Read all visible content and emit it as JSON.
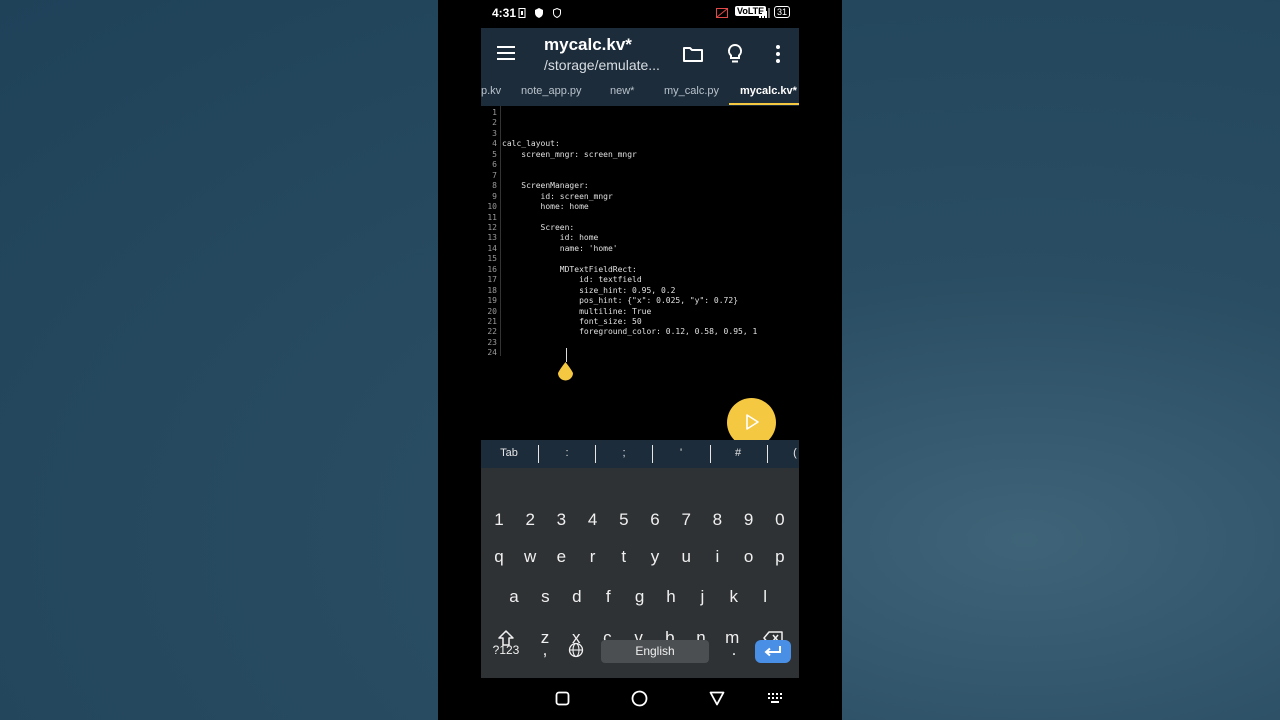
{
  "status_bar": {
    "time": "4:31",
    "network_badge": "VoLTE",
    "battery": "31"
  },
  "app_bar": {
    "title": "mycalc.kv*",
    "subtitle": "/storage/emulate...",
    "icons": [
      "menu-icon",
      "folder-icon",
      "lightbulb-icon",
      "more-vert-icon"
    ]
  },
  "tabs": [
    {
      "label": "p.kv"
    },
    {
      "label": "note_app.py"
    },
    {
      "label": "new*"
    },
    {
      "label": "my_calc.py"
    },
    {
      "label": "mycalc.kv*"
    }
  ],
  "editor": {
    "lines": [
      {
        "n": "1",
        "text": ""
      },
      {
        "n": "2",
        "text": ""
      },
      {
        "n": "3",
        "text": ""
      },
      {
        "n": "4",
        "text": "calc_layout:"
      },
      {
        "n": "5",
        "text": "    screen_mngr: screen_mngr"
      },
      {
        "n": "6",
        "text": ""
      },
      {
        "n": "7",
        "text": ""
      },
      {
        "n": "8",
        "text": "    ScreenManager:"
      },
      {
        "n": "9",
        "text": "        id: screen_mngr"
      },
      {
        "n": "10",
        "text": "        home: home"
      },
      {
        "n": "11",
        "text": ""
      },
      {
        "n": "12",
        "text": "        Screen:"
      },
      {
        "n": "13",
        "text": "            id: home"
      },
      {
        "n": "14",
        "text": "            name: 'home'"
      },
      {
        "n": "15",
        "text": ""
      },
      {
        "n": "16",
        "text": "            MDTextFieldRect:"
      },
      {
        "n": "17",
        "text": "                id: textfield"
      },
      {
        "n": "18",
        "text": "                size_hint: 0.95, 0.2"
      },
      {
        "n": "19",
        "text": "                pos_hint: {\"x\": 0.025, \"y\": 0.72}"
      },
      {
        "n": "20",
        "text": "                multiline: True"
      },
      {
        "n": "21",
        "text": "                font_size: 50"
      },
      {
        "n": "22",
        "text": "                foreground_color: 0.12, 0.58, 0.95, 1"
      },
      {
        "n": "23",
        "text": ""
      },
      {
        "n": "24",
        "text": ""
      }
    ]
  },
  "extra_keys": [
    "Tab",
    ":",
    ";",
    "'",
    "#",
    "("
  ],
  "keyboard": {
    "row1": [
      "1",
      "2",
      "3",
      "4",
      "5",
      "6",
      "7",
      "8",
      "9",
      "0"
    ],
    "row2": [
      "q",
      "w",
      "e",
      "r",
      "t",
      "y",
      "u",
      "i",
      "o",
      "p"
    ],
    "row3": [
      "a",
      "s",
      "d",
      "f",
      "g",
      "h",
      "j",
      "k",
      "l"
    ],
    "row4": [
      "z",
      "x",
      "c",
      "v",
      "b",
      "n",
      "m"
    ],
    "symbols_key": "?123",
    "comma_key": ",",
    "space_label": "English",
    "period_key": "."
  },
  "colors": {
    "accent": "#f5c842",
    "app_bar": "#1d2c3a",
    "enter_key": "#4a8fe6"
  }
}
